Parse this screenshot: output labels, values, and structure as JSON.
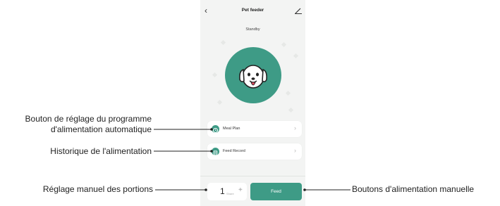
{
  "app": {
    "title": "Pet feeder",
    "status": "Standby"
  },
  "menu": [
    {
      "label": "Meal Plan",
      "icon": "clock-icon"
    },
    {
      "label": "Feed Record",
      "icon": "list-icon"
    }
  ],
  "portion": {
    "value": "1",
    "unit": "Share",
    "plus": "+"
  },
  "feed_button": {
    "label": "Feed"
  },
  "annotations": {
    "meal_plan_line1": "Bouton de réglage du programme",
    "meal_plan_line2": "d'alimentation automatique",
    "feed_record": "Historique de l'alimentation",
    "portion": "Réglage manuel des portions",
    "feed_button": "Boutons d'alimentation manuelle"
  },
  "colors": {
    "accent": "#3e9b86",
    "screen_background": "#f3f4f3"
  }
}
